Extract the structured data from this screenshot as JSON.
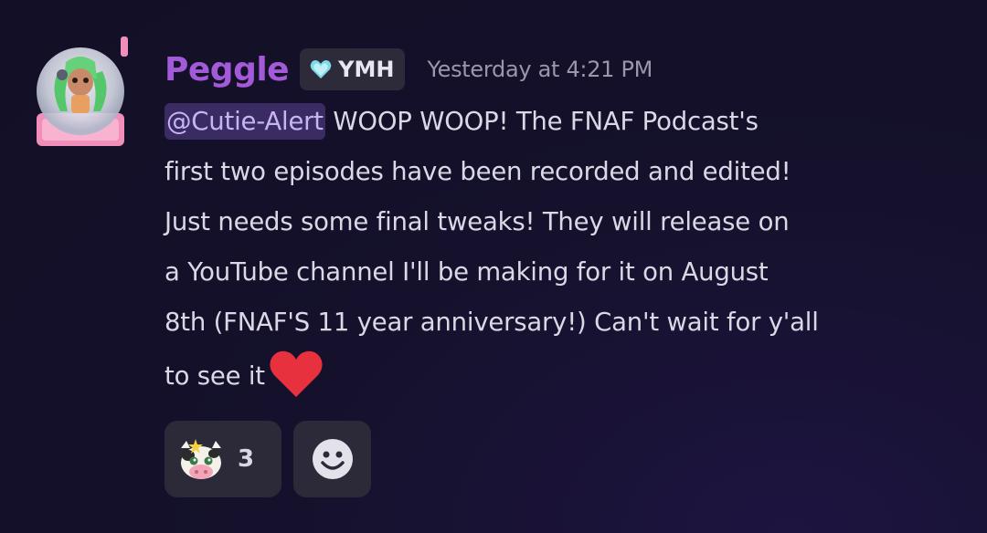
{
  "message": {
    "author": {
      "username": "Peggle",
      "avatar_icon": "snow-globe-doll-avatar",
      "username_color": "#a35ad8"
    },
    "tag": {
      "icon": "heart-badge-icon",
      "label": "YMH"
    },
    "timestamp": "Yesterday at 4:21 PM",
    "mention": "@Cutie-Alert",
    "content_lines": [
      " WOOP WOOP! The FNAF Podcast's",
      "first two episodes have been recorded and edited!",
      "Just needs some final tweaks! They will release on",
      "a YouTube channel I'll be making for it on August",
      "8th (FNAF'S 11 year anniversary!) Can't wait for y'all",
      "to see it"
    ],
    "trailing_emoji": "red-heart-icon"
  },
  "reactions": [
    {
      "emoji": "cow-emoji-icon",
      "count": "3"
    }
  ],
  "add_reaction": {
    "icon": "smiley-add-reaction-icon"
  }
}
